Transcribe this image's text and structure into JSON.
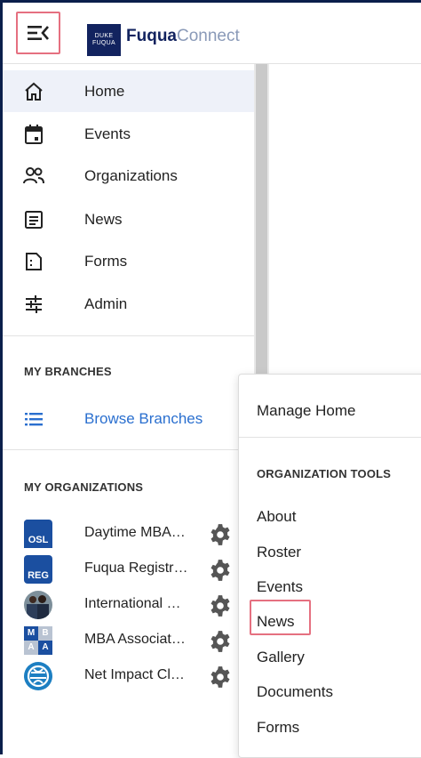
{
  "header": {
    "logo_line1": "DUKE",
    "logo_line2": "FUQUA",
    "brand_bold": "Fuqua",
    "brand_light": "Connect"
  },
  "sidebar": {
    "nav": [
      {
        "label": "Home",
        "icon": "home-icon",
        "active": true
      },
      {
        "label": "Events",
        "icon": "calendar-icon"
      },
      {
        "label": "Organizations",
        "icon": "people-icon"
      },
      {
        "label": "News",
        "icon": "news-icon"
      },
      {
        "label": "Forms",
        "icon": "form-icon"
      },
      {
        "label": "Admin",
        "icon": "sliders-icon"
      }
    ],
    "branches_title": "MY BRANCHES",
    "browse_label": "Browse Branches",
    "organizations_title": "MY ORGANIZATIONS",
    "organizations": [
      {
        "label": "Daytime MBA…",
        "avatar_text": "OSL"
      },
      {
        "label": "Fuqua Registr…",
        "avatar_text": "REG"
      },
      {
        "label": "International …"
      },
      {
        "label": "MBA Associat…",
        "avatar_text": [
          "M",
          "B",
          "A",
          "A"
        ]
      },
      {
        "label": "Net Impact Cl…"
      }
    ]
  },
  "popup": {
    "manage_label": "Manage Home",
    "tools_title": "ORGANIZATION TOOLS",
    "items": [
      "About",
      "Roster",
      "Events",
      "News",
      "Gallery",
      "Documents",
      "Forms"
    ]
  },
  "colors": {
    "navy": "#12235f",
    "accent_blue": "#2a6fcf",
    "highlight": "#e57080",
    "active_bg": "#eef1f9"
  }
}
